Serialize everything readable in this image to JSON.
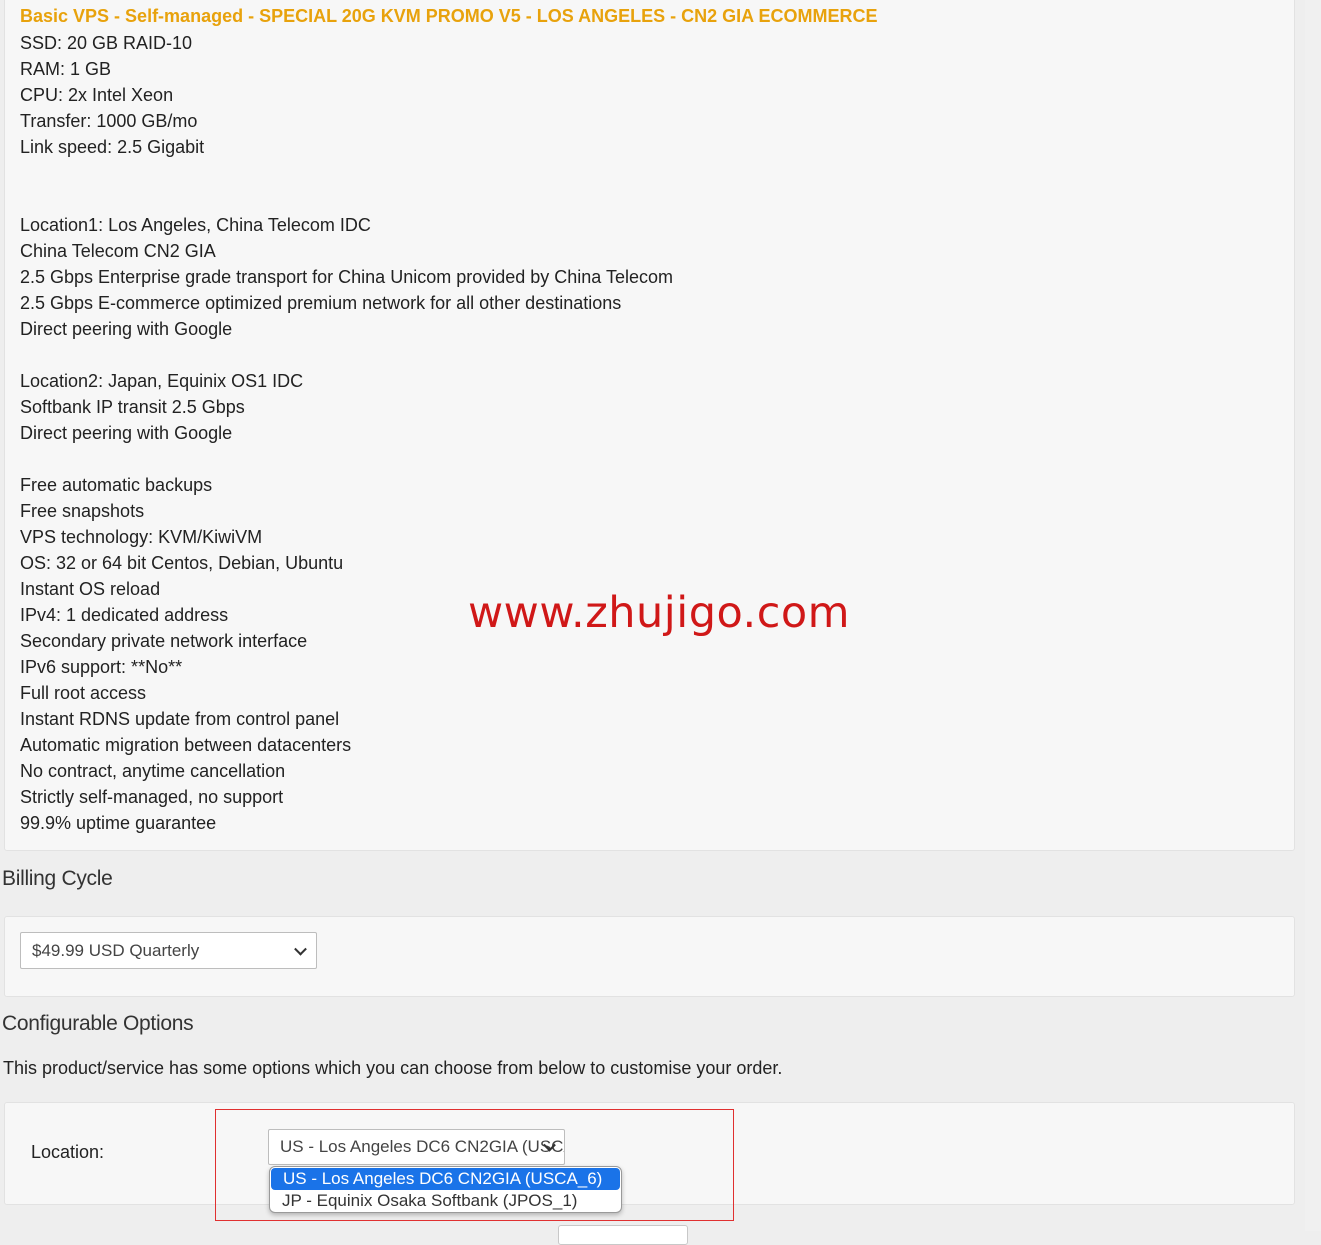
{
  "product": {
    "title": "Basic VPS - Self-managed - SPECIAL 20G KVM PROMO V5 - LOS ANGELES - CN2 GIA ECOMMERCE",
    "lines": [
      "SSD: 20 GB RAID-10",
      "RAM: 1 GB",
      "CPU: 2x Intel Xeon",
      "Transfer: 1000 GB/mo",
      "Link speed: 2.5 Gigabit",
      "",
      "",
      "Location1: Los Angeles, China Telecom IDC",
      "China Telecom CN2 GIA",
      "2.5 Gbps Enterprise grade transport for China Unicom provided by China Telecom",
      "2.5 Gbps E-commerce optimized premium network for all other destinations",
      "Direct peering with Google",
      "",
      "Location2: Japan, Equinix OS1 IDC",
      "Softbank IP transit 2.5 Gbps",
      "Direct peering with Google",
      "",
      "Free automatic backups",
      "Free snapshots",
      "VPS technology: KVM/KiwiVM",
      "OS: 32 or 64 bit Centos, Debian, Ubuntu",
      "Instant OS reload",
      "IPv4: 1 dedicated address",
      "Secondary private network interface",
      "IPv6 support: **No**",
      "Full root access",
      "Instant RDNS update from control panel",
      "Automatic migration between datacenters",
      "No contract, anytime cancellation",
      "Strictly self-managed, no support",
      "99.9% uptime guarantee"
    ]
  },
  "billing": {
    "heading": "Billing Cycle",
    "selected": "$49.99 USD Quarterly"
  },
  "config": {
    "heading": "Configurable Options",
    "description": "This product/service has some options which you can choose from below to customise your order.",
    "location_label": "Location:",
    "location_selected": "US - Los Angeles DC6 CN2GIA (USCA_6)",
    "location_options": [
      "US - Los Angeles DC6 CN2GIA (USCA_6)",
      "JP - Equinix Osaka Softbank (JPOS_1)"
    ]
  },
  "watermark": "www.zhujigo.com",
  "colors": {
    "title": "#e8a20c",
    "watermark": "#d01818",
    "highlight": "#e03030",
    "option_selected": "#1a73e8"
  },
  "icons": {
    "select_arrow": "chevron-down-icon"
  }
}
